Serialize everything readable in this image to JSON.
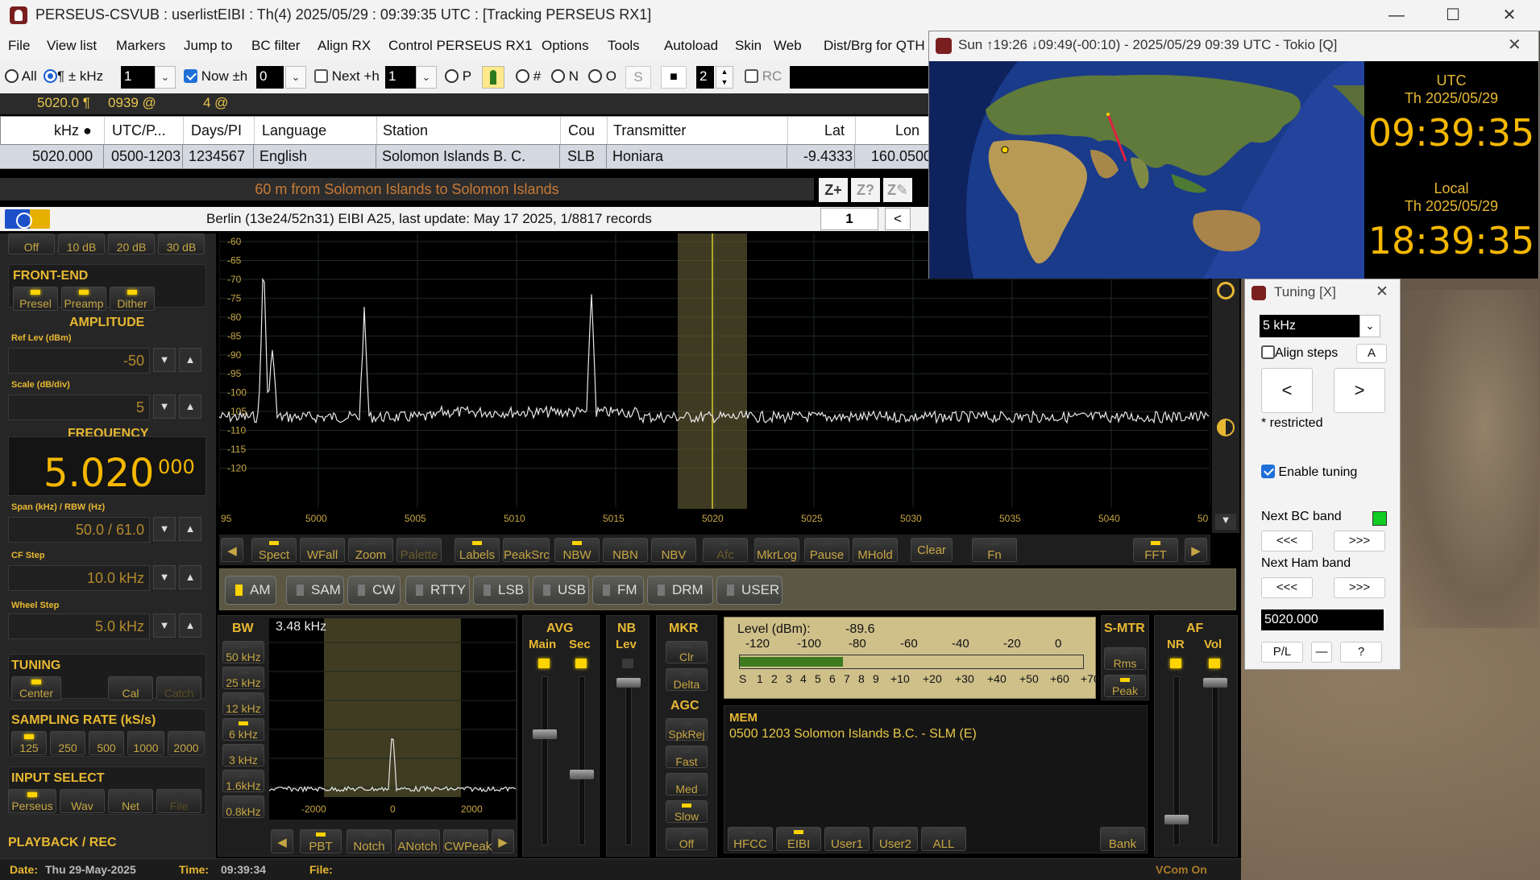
{
  "main_window": {
    "title": "PERSEUS-CSVUB : userlistEIBI : Th(4) 2025/05/29 : 09:39:35 UTC : [Tracking PERSEUS RX1]"
  },
  "window_controls": {
    "minimize": "—",
    "maximize": "☐",
    "close": "✕"
  },
  "menu": [
    "File",
    "View list",
    "Markers",
    "Jump to",
    "BC filter",
    "Align RX",
    "Control PERSEUS RX1",
    "Options",
    "Tools",
    "Autoload",
    "Skin",
    "Web",
    "Dist/Brg for QTH"
  ],
  "toolbar": {
    "all_label": "All",
    "pm_khz_label": "¶ ± kHz",
    "khz_value": "1",
    "now_label": "Now ±h",
    "now_value": "0",
    "next_label": "Next +h",
    "next_value": "1",
    "p_label": "P",
    "hash_label": "#",
    "n_label": "N",
    "o_label": "O",
    "s_label": "S",
    "stop_label": "■",
    "spin_value": "2",
    "rc_label": "RC"
  },
  "info_strip": {
    "freq": "5020.0 ¶",
    "time": "0939 @",
    "count": "4 @"
  },
  "table": {
    "headers": [
      "kHz ●",
      "UTC/P...",
      "Days/PI",
      "Language",
      "Station",
      "Cou",
      "Transmitter",
      "Lat",
      "Lon"
    ],
    "row": [
      "5020.000",
      "0500-1203",
      "1234567",
      "English",
      "Solomon Islands B. C.",
      "SLB",
      "Honiara",
      "-9.4333",
      "160.0500"
    ]
  },
  "route_text": "60 m from Solomon Islands to Solomon Islands",
  "zoom_buttons": [
    "Z+",
    "Z?",
    "Z✎"
  ],
  "db_bar": {
    "text": "Berlin (13e24/52n31) EIBI A25, last update: May 17 2025, 1/8817 records",
    "page": "1",
    "prev": "<"
  },
  "left_panel": {
    "atten_buttons": [
      "Off",
      "10 dB",
      "20 dB",
      "30 dB"
    ],
    "front_end_title": "FRONT-END",
    "front_end_buttons": [
      "Presel",
      "Preamp",
      "Dither"
    ],
    "amplitude_title": "AMPLITUDE",
    "ref_lev_label": "Ref Lev (dBm)",
    "ref_lev_value": "-50",
    "scale_label": "Scale (dB/div)",
    "scale_value": "5",
    "frequency_title": "FREQUENCY",
    "freq_main": "5.020",
    "freq_sub": "000",
    "span_label": "Span (kHz) / RBW (Hz)",
    "span_value": "50.0 / 61.0",
    "cf_step_label": "CF Step",
    "cf_step_value": "10.0 kHz",
    "wheel_step_label": "Wheel Step",
    "wheel_step_value": "5.0 kHz",
    "tuning_title": "TUNING",
    "tuning_buttons": [
      "Center",
      "Cal",
      "Catch"
    ],
    "sampling_title": "SAMPLING RATE (kS/s)",
    "sampling_buttons": [
      "125",
      "250",
      "500",
      "1000",
      "2000"
    ],
    "input_title": "INPUT SELECT",
    "input_buttons": [
      "Perseus",
      "Wav",
      "Net",
      "File"
    ],
    "playback_title": "PLAYBACK / REC"
  },
  "spectrum": {
    "y_labels": [
      "-60",
      "-65",
      "-70",
      "-75",
      "-80",
      "-85",
      "-90",
      "-95",
      "-100",
      "-105",
      "-110",
      "-115",
      "-120"
    ],
    "x_labels": [
      "95",
      "5000",
      "5005",
      "5010",
      "5015",
      "5020",
      "5025",
      "5030",
      "5035",
      "5040",
      "50"
    ],
    "trace_color": "#e8e8e8",
    "marker_color": "#d8c830",
    "passband_color": "#5a5430"
  },
  "spec_toolbar": [
    "Spect",
    "WFall",
    "Zoom",
    "Palette",
    "Labels",
    "PeakSrc",
    "NBW",
    "NBN",
    "NBV",
    "Afc",
    "MkrLog",
    "Pause",
    "MHold",
    "Clear",
    "Fn",
    "FFT"
  ],
  "modes": [
    "AM",
    "SAM",
    "CW",
    "RTTY",
    "LSB",
    "USB",
    "FM",
    "DRM",
    "USER"
  ],
  "bw_panel": {
    "title": "BW",
    "value": "3.48 kHz",
    "buttons": [
      "50 kHz",
      "25 kHz",
      "12 kHz",
      "6 kHz",
      "3 kHz",
      "1.6kHz",
      "0.8kHz"
    ],
    "x_labels": [
      "-2000",
      "0",
      "2000"
    ],
    "bottom_buttons": [
      "PBT",
      "Notch",
      "ANotch",
      "CWPeak"
    ]
  },
  "avg_panel": {
    "title": "AVG",
    "main": "Main",
    "sec": "Sec"
  },
  "nb_panel": {
    "title": "NB",
    "lev": "Lev"
  },
  "mkr_panel": {
    "title": "MKR",
    "buttons": [
      "Clr",
      "Delta"
    ],
    "agc_title": "AGC",
    "agc_buttons": [
      "SpkRej",
      "Fast",
      "Med",
      "Slow",
      "Off"
    ]
  },
  "level_meter": {
    "label": "Level (dBm):",
    "value": "-89.6",
    "scale_top": [
      "-120",
      "-100",
      "-80",
      "-60",
      "-40",
      "-20",
      "0"
    ],
    "scale_bottom": [
      "S",
      "1",
      "2",
      "3",
      "4",
      "5",
      "6",
      "7",
      "8",
      "9",
      "+10",
      "+20",
      "+30",
      "+40",
      "+50",
      "+60",
      "+70"
    ]
  },
  "smtr_panel": {
    "title": "S-MTR",
    "buttons": [
      "Rms",
      "Peak"
    ]
  },
  "af_panel": {
    "title": "AF",
    "nr": "NR",
    "vol": "Vol"
  },
  "mem_panel": {
    "title": "MEM",
    "entry": "0500 1203 Solomon Islands B.C.  - SLM (E)",
    "buttons": [
      "HFCC",
      "EIBI",
      "User1",
      "User2",
      "ALL",
      "Bank"
    ]
  },
  "status_bar": {
    "date_label": "Date:",
    "date_value": "Thu 29-May-2025",
    "time_label": "Time:",
    "time_value": "09:39:34",
    "file_label": "File:",
    "vcom": "VCom On"
  },
  "sun_window": {
    "title": "Sun ↑19:26 ↓09:49(-00:10) - 2025/05/29 09:39 UTC - Tokio [Q]",
    "close": "✕",
    "utc_label": "UTC",
    "utc_date": "Th 2025/05/29",
    "utc_time": "09:39:35",
    "local_label": "Local",
    "local_date": "Th 2025/05/29",
    "local_time": "18:39:35"
  },
  "tuning_window": {
    "title": "Tuning [X]",
    "close": "✕",
    "step_value": "5 kHz",
    "align_steps": "Align steps",
    "a_label": "A",
    "left": "<",
    "right": ">",
    "restricted": "* restricted",
    "enable_tuning": "Enable tuning",
    "next_bc": "Next BC band",
    "next_ham": "Next Ham band",
    "back": "<<<",
    "fwd": ">>>",
    "freq": "5020.000",
    "pl": "P/L",
    "minus": "—",
    "help": "?"
  }
}
